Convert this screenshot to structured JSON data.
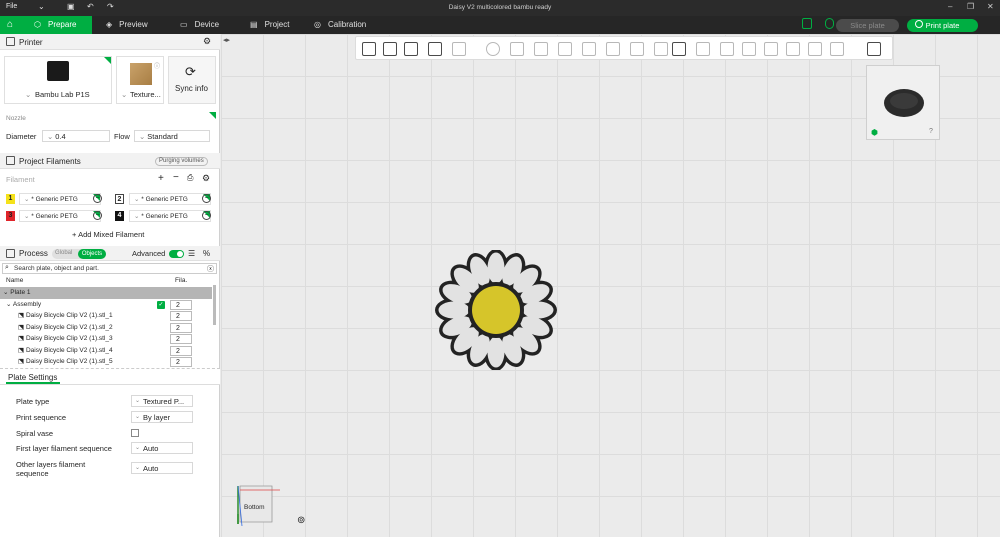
{
  "window": {
    "title": "Daisy V2 multicolored bambu ready",
    "file_menu": "File"
  },
  "tabs": [
    {
      "label": "Prepare"
    },
    {
      "label": "Preview"
    },
    {
      "label": "Device"
    },
    {
      "label": "Project"
    },
    {
      "label": "Calibration"
    }
  ],
  "actions": {
    "slice": "Slice plate",
    "print": "Print plate"
  },
  "printer": {
    "section_title": "Printer",
    "name": "Bambu Lab P1S",
    "plate": "Texture...",
    "sync": "Sync info",
    "nozzle_label": "Nozzle",
    "diameter_label": "Diameter",
    "diameter_value": "0.4",
    "flow_label": "Flow",
    "flow_value": "Standard"
  },
  "filaments": {
    "section_title": "Project Filaments",
    "purging_button": "Purging volumes",
    "filament_label": "Filament",
    "items": [
      {
        "num": "1",
        "name": "* Generic PETG",
        "color": "#f5e21a",
        "text_color": "#222"
      },
      {
        "num": "2",
        "name": "* Generic PETG",
        "color": "#ffffff",
        "text_color": "#222"
      },
      {
        "num": "3",
        "name": "* Generic PETG",
        "color": "#e0242a",
        "text_color": "#222"
      },
      {
        "num": "4",
        "name": "* Generic PETG",
        "color": "#111111",
        "text_color": "#fff"
      }
    ],
    "add_mixed": "Add Mixed Filament"
  },
  "process": {
    "section_title": "Process",
    "global": "Global",
    "objects": "Objects",
    "advanced": "Advanced",
    "search_placeholder": "Search plate, object and part.",
    "col_name": "Name",
    "col_fila": "Fila.",
    "plate": "Plate 1",
    "assembly": "Assembly",
    "assembly_fila": "2",
    "parts": [
      {
        "name": "Daisy Bicycle Clip V2 (1).stl_1",
        "fila": "2"
      },
      {
        "name": "Daisy Bicycle Clip V2 (1).stl_2",
        "fila": "2"
      },
      {
        "name": "Daisy Bicycle Clip V2 (1).stl_3",
        "fila": "2"
      },
      {
        "name": "Daisy Bicycle Clip V2 (1).stl_4",
        "fila": "2"
      },
      {
        "name": "Daisy Bicycle Clip V2 (1).stl_5",
        "fila": "2"
      }
    ]
  },
  "plate_settings": {
    "tab": "Plate Settings",
    "rows": [
      {
        "label": "Plate type",
        "value": "Textured P..."
      },
      {
        "label": "Print sequence",
        "value": "By layer"
      },
      {
        "label": "Spiral vase",
        "value": ""
      },
      {
        "label": "First layer filament sequence",
        "value": "Auto"
      },
      {
        "label": "Other layers filament sequence",
        "value": "Auto"
      }
    ]
  },
  "viewport": {
    "cube_face": "Bottom",
    "daisy_center_color": "#d6c52a",
    "petal_color": "#e2e2e2",
    "outline_color": "#232323"
  }
}
